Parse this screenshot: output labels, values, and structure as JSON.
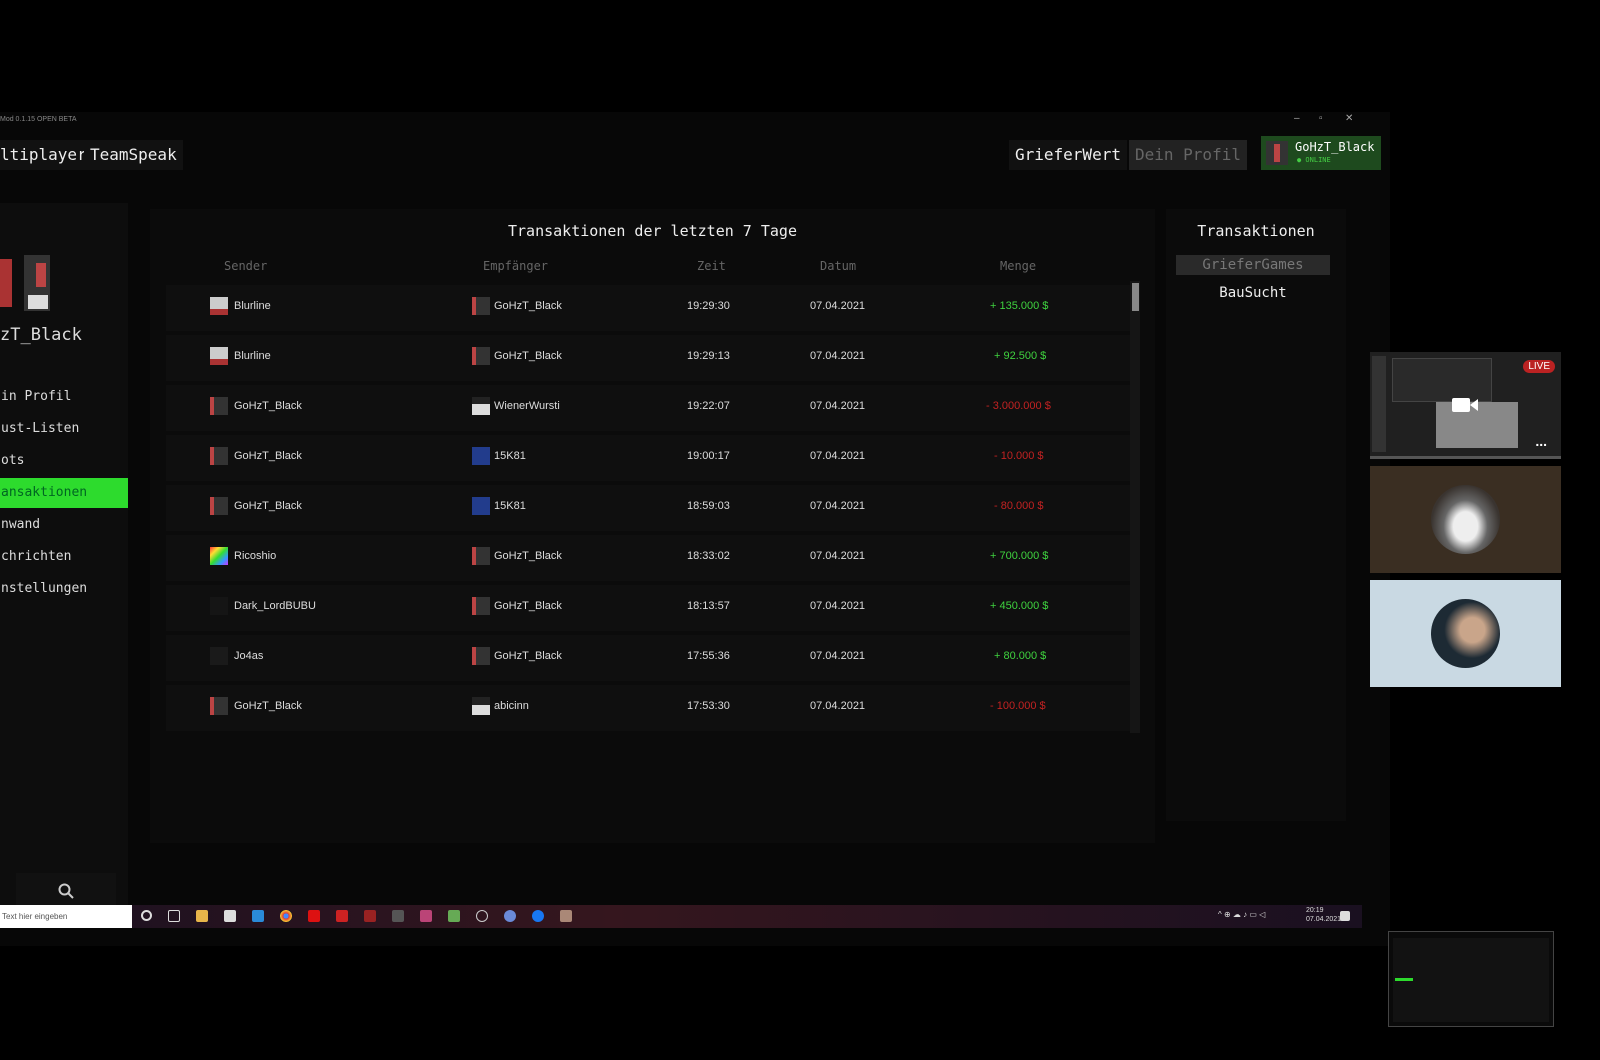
{
  "window": {
    "title": "Mod 0.1.15 OPEN BETA",
    "controls": [
      "–",
      "▫",
      "✕"
    ]
  },
  "topnav": {
    "multiplayer": "ltiplayer",
    "teamspeak": "TeamSpeak",
    "grieferwert": "GrieferWert",
    "dein_profil": "Dein Profil",
    "user_name": "GoHzT_Black",
    "user_status": "● ONLINE"
  },
  "sidebar": {
    "username": "zT_Black",
    "items": [
      {
        "label": "in Profil"
      },
      {
        "label": "ust-Listen"
      },
      {
        "label": "ots"
      },
      {
        "label": "ansaktionen"
      },
      {
        "label": "nwand"
      },
      {
        "label": "chrichten"
      },
      {
        "label": "nstellungen"
      }
    ]
  },
  "transactions": {
    "title": "Transaktionen der letzten 7 Tage",
    "columns": [
      "Sender",
      "Empfänger",
      "Zeit",
      "Datum",
      "Menge"
    ],
    "rows": [
      {
        "sender": "Blurline",
        "receiver": "GoHzT_Black",
        "time": "19:29:30",
        "date": "07.04.2021",
        "amount": "+ 135.000 $"
      },
      {
        "sender": "Blurline",
        "receiver": "GoHzT_Black",
        "time": "19:29:13",
        "date": "07.04.2021",
        "amount": "+ 92.500 $"
      },
      {
        "sender": "GoHzT_Black",
        "receiver": "WienerWursti",
        "time": "19:22:07",
        "date": "07.04.2021",
        "amount": "- 3.000.000 $"
      },
      {
        "sender": "GoHzT_Black",
        "receiver": "15K81",
        "time": "19:00:17",
        "date": "07.04.2021",
        "amount": "- 10.000 $"
      },
      {
        "sender": "GoHzT_Black",
        "receiver": "15K81",
        "time": "18:59:03",
        "date": "07.04.2021",
        "amount": "- 80.000 $"
      },
      {
        "sender": "Ricoshio",
        "receiver": "GoHzT_Black",
        "time": "18:33:02",
        "date": "07.04.2021",
        "amount": "+ 700.000 $"
      },
      {
        "sender": "Dark_LordBUBU",
        "receiver": "GoHzT_Black",
        "time": "18:13:57",
        "date": "07.04.2021",
        "amount": "+ 450.000 $"
      },
      {
        "sender": "Jo4as",
        "receiver": "GoHzT_Black",
        "time": "17:55:36",
        "date": "07.04.2021",
        "amount": "+ 80.000 $"
      },
      {
        "sender": "GoHzT_Black",
        "receiver": "abicinn",
        "time": "17:53:30",
        "date": "07.04.2021",
        "amount": "- 100.000 $"
      }
    ]
  },
  "side_panel": {
    "title": "Transaktionen",
    "buttons": [
      "GrieferGames",
      "BauSucht"
    ]
  },
  "taskbar": {
    "search_placeholder": "Text hier eingeben",
    "clock_time": "20:19",
    "clock_date": "07.04.2021"
  },
  "video_tiles": {
    "live_label": "LIVE",
    "more": "..."
  },
  "colors": {
    "accent_green": "#2ddb2d",
    "positive": "#3fd23f",
    "negative": "#c22222"
  }
}
